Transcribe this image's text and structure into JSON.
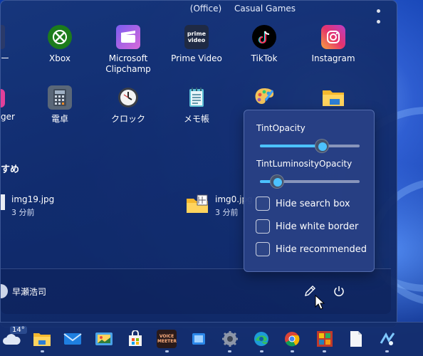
{
  "top_labels": [
    "(Office)",
    "Casual Games"
  ],
  "pinned_row1": [
    {
      "label": "Xbox",
      "icon": "xbox-icon"
    },
    {
      "label": "Microsoft Clipchamp",
      "icon": "clipchamp-icon"
    },
    {
      "label": "Prime Video",
      "icon": "prime-video-icon"
    },
    {
      "label": "TikTok",
      "icon": "tiktok-icon"
    },
    {
      "label": "Instagram",
      "icon": "instagram-icon"
    }
  ],
  "pinned_row2": [
    {
      "label": "電卓",
      "icon": "calculator-icon"
    },
    {
      "label": "クロック",
      "icon": "clock-icon"
    },
    {
      "label": "メモ帳",
      "icon": "notepad-icon"
    },
    {
      "label": "",
      "icon": "paint-icon"
    },
    {
      "label": "",
      "icon": "file-explorer-icon"
    }
  ],
  "partial_labels": [
    "ー",
    "ger"
  ],
  "prime_text": "prime video",
  "recommended_title": "すめ",
  "recent_files": [
    {
      "name": "img19.jpg",
      "time": "3 分前"
    },
    {
      "name": "img0.jpg",
      "time": "3 分前"
    }
  ],
  "user_name": "早瀬浩司",
  "flyout": {
    "tint_opacity_label": "TintOpacity",
    "tint_opacity_value": 0.62,
    "tint_luminosity_label": "TintLuminosityOpacity",
    "tint_luminosity_value": 0.17,
    "checkboxes": [
      {
        "label": "Hide search box",
        "checked": false
      },
      {
        "label": "Hide white border",
        "checked": false
      },
      {
        "label": "Hide recommended",
        "checked": false
      }
    ]
  },
  "taskbar": {
    "weather_temp": "14°",
    "voice_meeter_text": "VOICE MEETER",
    "items": [
      "weather-icon",
      "file-explorer-icon",
      "mail-icon",
      "photos-icon",
      "store-icon",
      "voicemeeter-icon",
      "app-icon",
      "settings-icon",
      "edge-icon",
      "chrome-icon",
      "game-icon",
      "document-icon",
      "app-icon"
    ]
  },
  "colors": {
    "accent": "#4cc2ff"
  }
}
